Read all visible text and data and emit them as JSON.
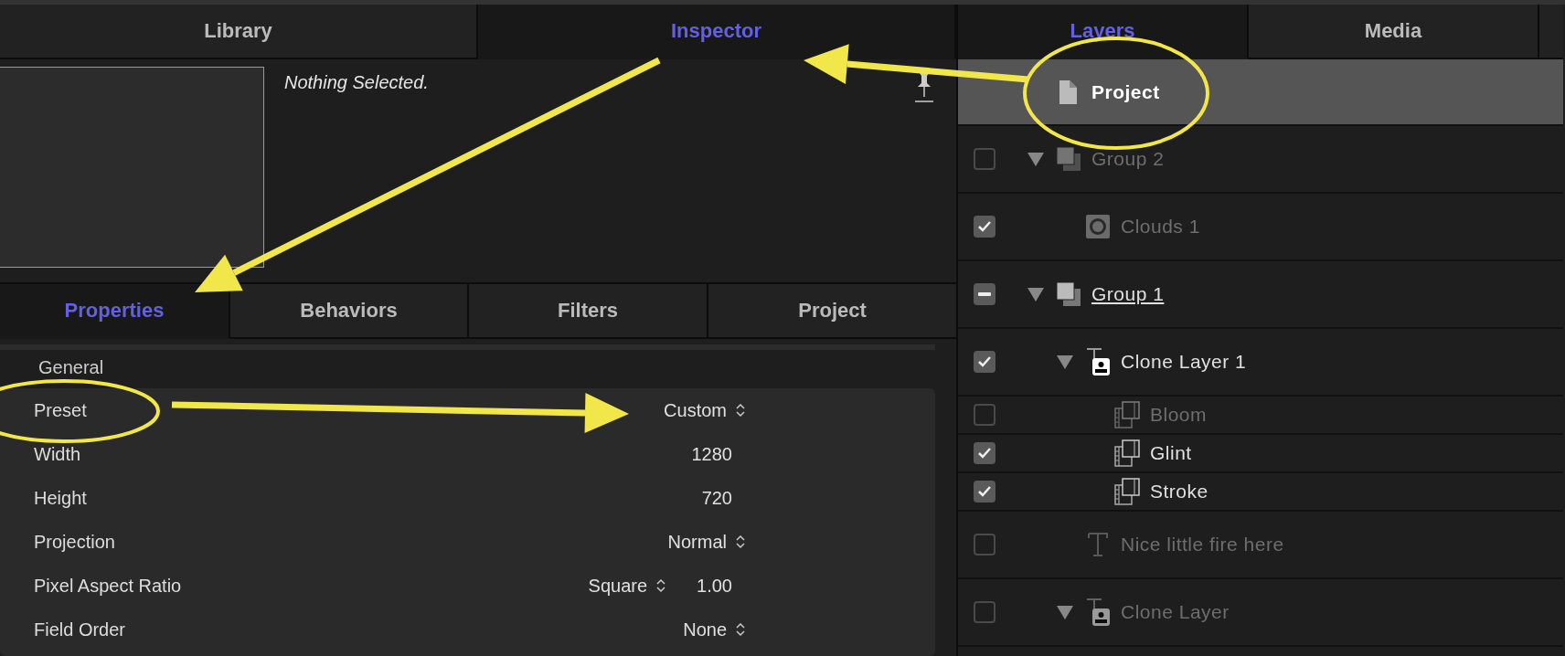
{
  "left_tabs": [
    {
      "label": "Library",
      "selected": false
    },
    {
      "label": "Inspector",
      "selected": true
    }
  ],
  "preview": {
    "status": "Nothing Selected."
  },
  "inspector_tabs": [
    {
      "label": "Properties",
      "selected": true
    },
    {
      "label": "Behaviors",
      "selected": false
    },
    {
      "label": "Filters",
      "selected": false
    },
    {
      "label": "Project",
      "selected": false
    }
  ],
  "properties": {
    "section": "General",
    "rows": [
      {
        "label": "Preset",
        "kind": "popup",
        "value": "Custom"
      },
      {
        "label": "Width",
        "kind": "number",
        "value": "1280"
      },
      {
        "label": "Height",
        "kind": "number",
        "value": "720"
      },
      {
        "label": "Projection",
        "kind": "popup",
        "value": "Normal"
      },
      {
        "label": "Pixel Aspect Ratio",
        "kind": "popup_number",
        "value": "Square",
        "number": "1.00"
      },
      {
        "label": "Field Order",
        "kind": "popup",
        "value": "None"
      }
    ]
  },
  "right_tabs": [
    {
      "label": "Layers",
      "selected": true
    },
    {
      "label": "Media",
      "selected": false
    }
  ],
  "layers": [
    {
      "name": "Project",
      "kind": "project",
      "selected": true,
      "dimmed": false,
      "underlined": false
    },
    {
      "name": "Group 2",
      "kind": "group",
      "checked": false,
      "expanded": true,
      "selected": false,
      "dimmed": true,
      "underlined": false,
      "children": [
        {
          "name": "Clouds 1",
          "kind": "generator",
          "checked": true,
          "selected": false,
          "dimmed": true,
          "underlined": false
        }
      ]
    },
    {
      "name": "Group 1",
      "kind": "group",
      "checked": true,
      "mixed": true,
      "expanded": true,
      "selected": false,
      "dimmed": false,
      "underlined": true,
      "children": [
        {
          "name": "Clone Layer 1",
          "kind": "clone",
          "checked": true,
          "expanded": true,
          "selected": false,
          "dimmed": false,
          "underlined": false,
          "children": [
            {
              "name": "Bloom",
              "kind": "filter",
              "checked": false,
              "selected": false,
              "dimmed": true,
              "underlined": false
            },
            {
              "name": "Glint",
              "kind": "filter",
              "checked": true,
              "selected": false,
              "dimmed": false,
              "underlined": false
            },
            {
              "name": "Stroke",
              "kind": "filter",
              "checked": true,
              "selected": false,
              "dimmed": false,
              "underlined": false
            }
          ]
        },
        {
          "name": "Nice little fire here",
          "kind": "text",
          "checked": false,
          "selected": false,
          "dimmed": true,
          "underlined": false
        },
        {
          "name": "Clone Layer",
          "kind": "clone",
          "checked": false,
          "expanded": true,
          "selected": false,
          "dimmed": true,
          "underlined": false
        }
      ]
    }
  ],
  "annotations": [
    {
      "kind": "arrow"
    },
    {
      "kind": "arrow"
    },
    {
      "kind": "arrow"
    },
    {
      "kind": "ellipse"
    },
    {
      "kind": "ellipse"
    }
  ]
}
